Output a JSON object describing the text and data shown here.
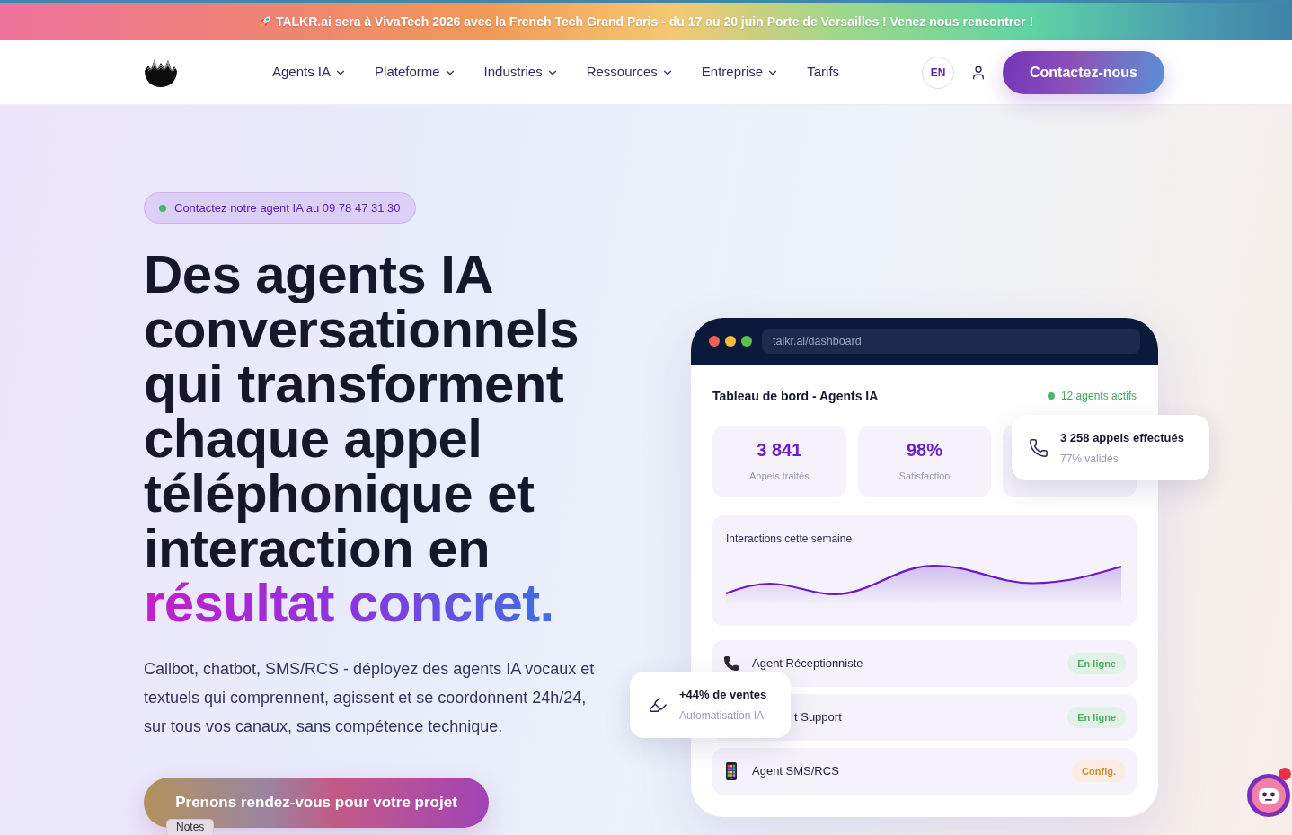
{
  "announcement": {
    "text": "TALKR.ai sera à **VivaTech 2026** avec la **French Tech Grand Paris - du 17 au 20 juin** Porte de Versailles ! Venez nous rencontrer !"
  },
  "nav": {
    "links": [
      {
        "label": "Agents IA",
        "has_menu": true
      },
      {
        "label": "Plateforme",
        "has_menu": true
      },
      {
        "label": "Industries",
        "has_menu": true
      },
      {
        "label": "Ressources",
        "has_menu": true
      },
      {
        "label": "Entreprise",
        "has_menu": true
      },
      {
        "label": "Tarifs",
        "has_menu": false
      }
    ],
    "language": "EN",
    "cta": "Contactez-nous"
  },
  "hero": {
    "contact_pill": "Contactez notre agent IA au 09 78 47 31 30",
    "heading": "Des agents IA conversationnels qui transforment chaque appel téléphonique et interaction en",
    "heading_highlight": "résultat concret.",
    "description": "Callbot, chatbot, SMS/RCS - déployez des agents IA vocaux et textuels qui comprennent, agissent et se coordonnent 24h/24, sur tous vos canaux, sans compétence technique.",
    "cta": "Prenons rendez-vous pour votre projet"
  },
  "dashboard": {
    "url": "talkr.ai/dashboard",
    "title": "Tableau de bord - Agents IA",
    "status": "12 agents actifs",
    "stats": [
      {
        "value": "3 841",
        "label": "Appels traités"
      },
      {
        "value": "98%",
        "label": "Satisfaction"
      }
    ],
    "chart_title": "Interactions cette semaine",
    "agents": [
      {
        "kind": "phone",
        "name": "Agent Réceptionniste",
        "status": {
          "kind": "online",
          "label": "En ligne"
        }
      },
      {
        "kind": "covered",
        "name": "t Support",
        "status": {
          "kind": "online",
          "label": "En ligne"
        }
      },
      {
        "kind": "mobile",
        "name": "Agent SMS/RCS",
        "status": {
          "kind": "setup",
          "label": "Config."
        }
      }
    ]
  },
  "callouts": [
    {
      "kind": "phone",
      "title": "3 258 appels effectués",
      "subtitle": "77% validés"
    },
    {
      "kind": "marker",
      "title": "+44% de ventes",
      "subtitle": "Automatisation IA"
    }
  ],
  "notes_tab": "Notes"
}
